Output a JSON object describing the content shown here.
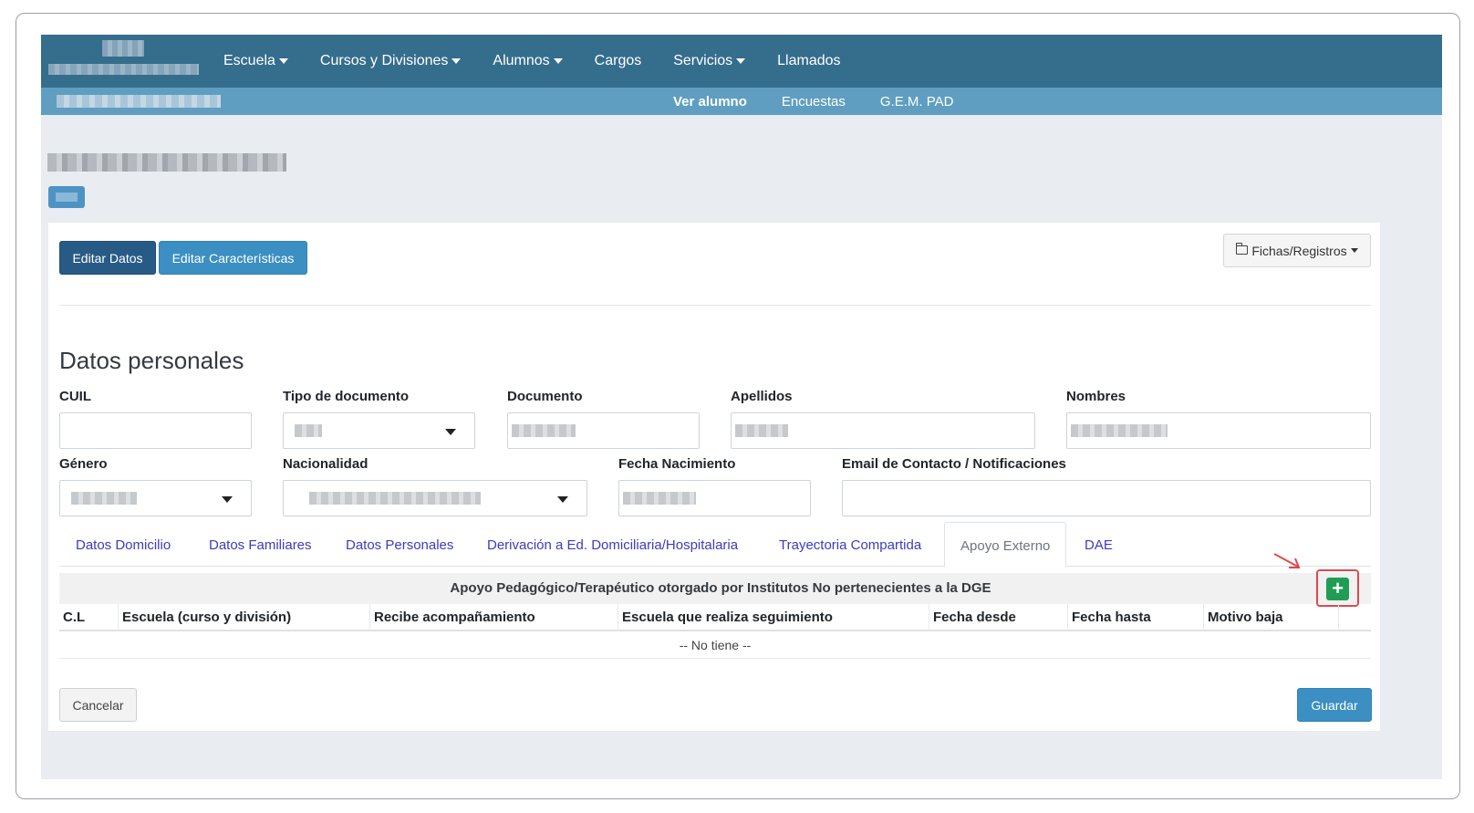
{
  "navbar": {
    "menu": [
      {
        "label": "Escuela",
        "dropdown": true
      },
      {
        "label": "Cursos y Divisiones",
        "dropdown": true
      },
      {
        "label": "Alumnos",
        "dropdown": true
      },
      {
        "label": "Cargos",
        "dropdown": false
      },
      {
        "label": "Servicios",
        "dropdown": true
      },
      {
        "label": "Llamados",
        "dropdown": false
      }
    ],
    "sub_menu": [
      {
        "label": "Ver alumno",
        "active": true
      },
      {
        "label": "Encuestas",
        "active": false
      },
      {
        "label": "G.E.M. PAD",
        "active": false
      }
    ]
  },
  "actions": {
    "editar_datos": "Editar Datos",
    "editar_caracteristicas": "Editar Características",
    "fichas": "Fichas/Registros"
  },
  "section": {
    "title": "Datos personales",
    "labels": {
      "cuil": "CUIL",
      "tipo_documento": "Tipo de documento",
      "documento": "Documento",
      "apellidos": "Apellidos",
      "nombres": "Nombres",
      "genero": "Género",
      "nacionalidad": "Nacionalidad",
      "fecha_nacimiento": "Fecha Nacimiento",
      "email": "Email de Contacto / Notificaciones"
    }
  },
  "tabs": [
    {
      "label": "Datos Domicilio",
      "active": false
    },
    {
      "label": "Datos Familiares",
      "active": false
    },
    {
      "label": "Datos Personales",
      "active": false
    },
    {
      "label": "Derivación a Ed. Domiciliaria/Hospitalaria",
      "active": false
    },
    {
      "label": "Trayectoria Compartida",
      "active": false
    },
    {
      "label": "Apoyo Externo",
      "active": true
    },
    {
      "label": "DAE",
      "active": false
    }
  ],
  "table": {
    "title": "Apoyo Pedagógico/Terapéutico otorgado por Institutos No pertenecientes a la DGE",
    "add_symbol": "+",
    "columns": [
      "C.L",
      "Escuela (curso y división)",
      "Recibe acompañamiento",
      "Escuela que realiza seguimiento",
      "Fecha desde",
      "Fecha hasta",
      "Motivo baja"
    ],
    "empty": "-- No tiene --"
  },
  "footer": {
    "cancel": "Cancelar",
    "save": "Guardar"
  },
  "colors": {
    "navbar": "#356d8d",
    "subnav": "#5f9ec0",
    "primary_dark": "#275b85",
    "primary": "#3b8fc2",
    "success": "#1f9d55",
    "highlight": "#e0474c",
    "tab_link": "#3b3bc4"
  }
}
